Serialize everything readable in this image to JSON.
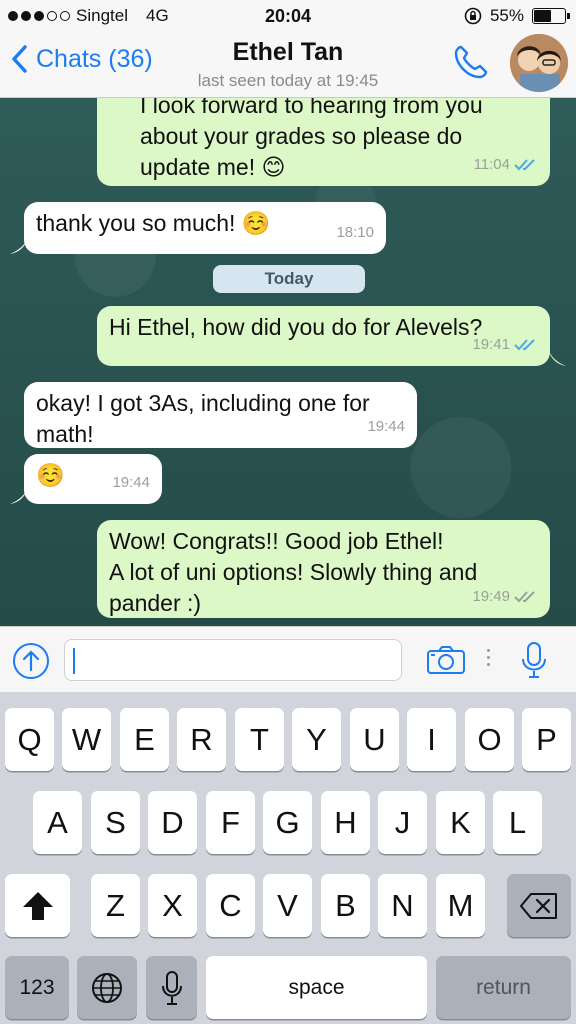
{
  "status_bar": {
    "carrier": "Singtel",
    "network": "4G",
    "time": "20:04",
    "battery_percent": "55%",
    "battery_level": 0.55
  },
  "header": {
    "back_label": "Chats (36)",
    "contact_name": "Ethel Tan",
    "last_seen": "last seen today at 19:45"
  },
  "messages": [
    {
      "direction": "out",
      "lines": [
        "I look forward to hearing from you",
        "about your grades so please do",
        "update me! 😊"
      ],
      "time": "11:04",
      "status": "read"
    },
    {
      "direction": "in",
      "lines": [
        "thank you so much! ☺️"
      ],
      "time": "18:10"
    },
    {
      "direction": "out",
      "lines": [
        "Hi Ethel, how did you do for Alevels?"
      ],
      "time": "19:41",
      "status": "read"
    },
    {
      "direction": "in",
      "lines": [
        "okay! I got 3As, including one for",
        "math!"
      ],
      "time": "19:44"
    },
    {
      "direction": "in",
      "lines": [
        "☺️"
      ],
      "time": "19:44"
    },
    {
      "direction": "out",
      "lines": [
        "Wow! Congrats!! Good job Ethel!",
        "A lot of uni options! Slowly thing and",
        "pander :)"
      ],
      "time": "19:49",
      "status": "delivered"
    }
  ],
  "date_separator": "Today",
  "input": {
    "placeholder": ""
  },
  "keyboard": {
    "row1": [
      "Q",
      "W",
      "E",
      "R",
      "T",
      "Y",
      "U",
      "I",
      "O",
      "P"
    ],
    "row2": [
      "A",
      "S",
      "D",
      "F",
      "G",
      "H",
      "J",
      "K",
      "L"
    ],
    "row3": [
      "Z",
      "X",
      "C",
      "V",
      "B",
      "N",
      "M"
    ],
    "numbers_label": "123",
    "space_label": "space",
    "return_label": "return"
  },
  "colors": {
    "accent": "#1c7cf4",
    "outgoing_bubble": "#dcf8c6",
    "incoming_bubble": "#ffffff",
    "read_ticks": "#4fa8e8",
    "delivered_ticks": "#9aa09a"
  }
}
